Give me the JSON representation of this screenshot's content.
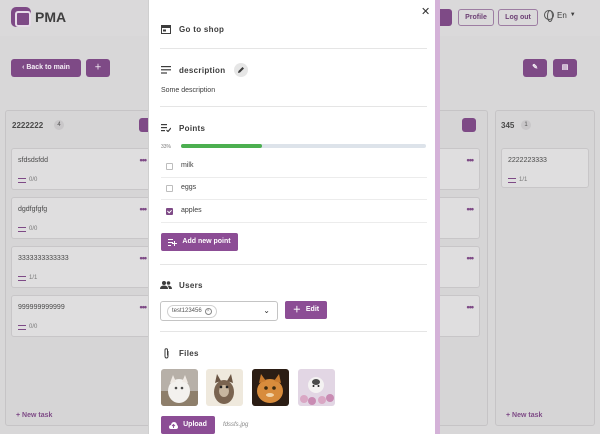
{
  "app": {
    "name": "PMA"
  },
  "header": {
    "profile_label": "Profile",
    "logout_label": "Log out",
    "language": "En"
  },
  "toolbar": {
    "back_label": "Back to main"
  },
  "columns": [
    {
      "title": "2222222",
      "count": "4",
      "tasks": [
        {
          "title": "sfdsdsfdd",
          "progress": "0/0"
        },
        {
          "title": "dgdfgfgfg",
          "progress": "0/0"
        },
        {
          "title": "3333333333333",
          "progress": "1/1"
        },
        {
          "title": "999999999999",
          "progress": "0/0"
        }
      ],
      "new_task_label": "+ New task"
    },
    {
      "title": "345",
      "count": "1",
      "tasks": [
        {
          "title": "2222223333",
          "progress": "1/1"
        }
      ],
      "new_task_label": "+ New task"
    }
  ],
  "modal": {
    "shop_label": "Go to shop",
    "description_title": "description",
    "description_text": "Some description",
    "points_title": "Points",
    "progress_label": "33%",
    "progress_fraction": 0.33,
    "points": [
      {
        "label": "milk",
        "checked": false
      },
      {
        "label": "eggs",
        "checked": false
      },
      {
        "label": "apples",
        "checked": true
      }
    ],
    "add_point_label": "Add new point",
    "users_title": "Users",
    "selected_user": "test123456",
    "edit_label": "Edit",
    "files_title": "Files",
    "files": [
      {
        "alt": "white kitten"
      },
      {
        "alt": "tabby kitten"
      },
      {
        "alt": "orange cat"
      },
      {
        "alt": "kitten with flowers"
      }
    ],
    "upload_label": "Upload",
    "uploaded_file": "fdssfs.jpg"
  },
  "colors": {
    "accent": "#8c4d95",
    "progress": "#4caf50",
    "overlay": "#d8d7d8"
  },
  "icons": [
    "close-icon",
    "shop-icon",
    "description-icon",
    "pencil-icon",
    "checklist-icon",
    "people-icon",
    "paperclip-icon",
    "cloud-upload-icon",
    "add-user-icon",
    "globe-icon"
  ]
}
